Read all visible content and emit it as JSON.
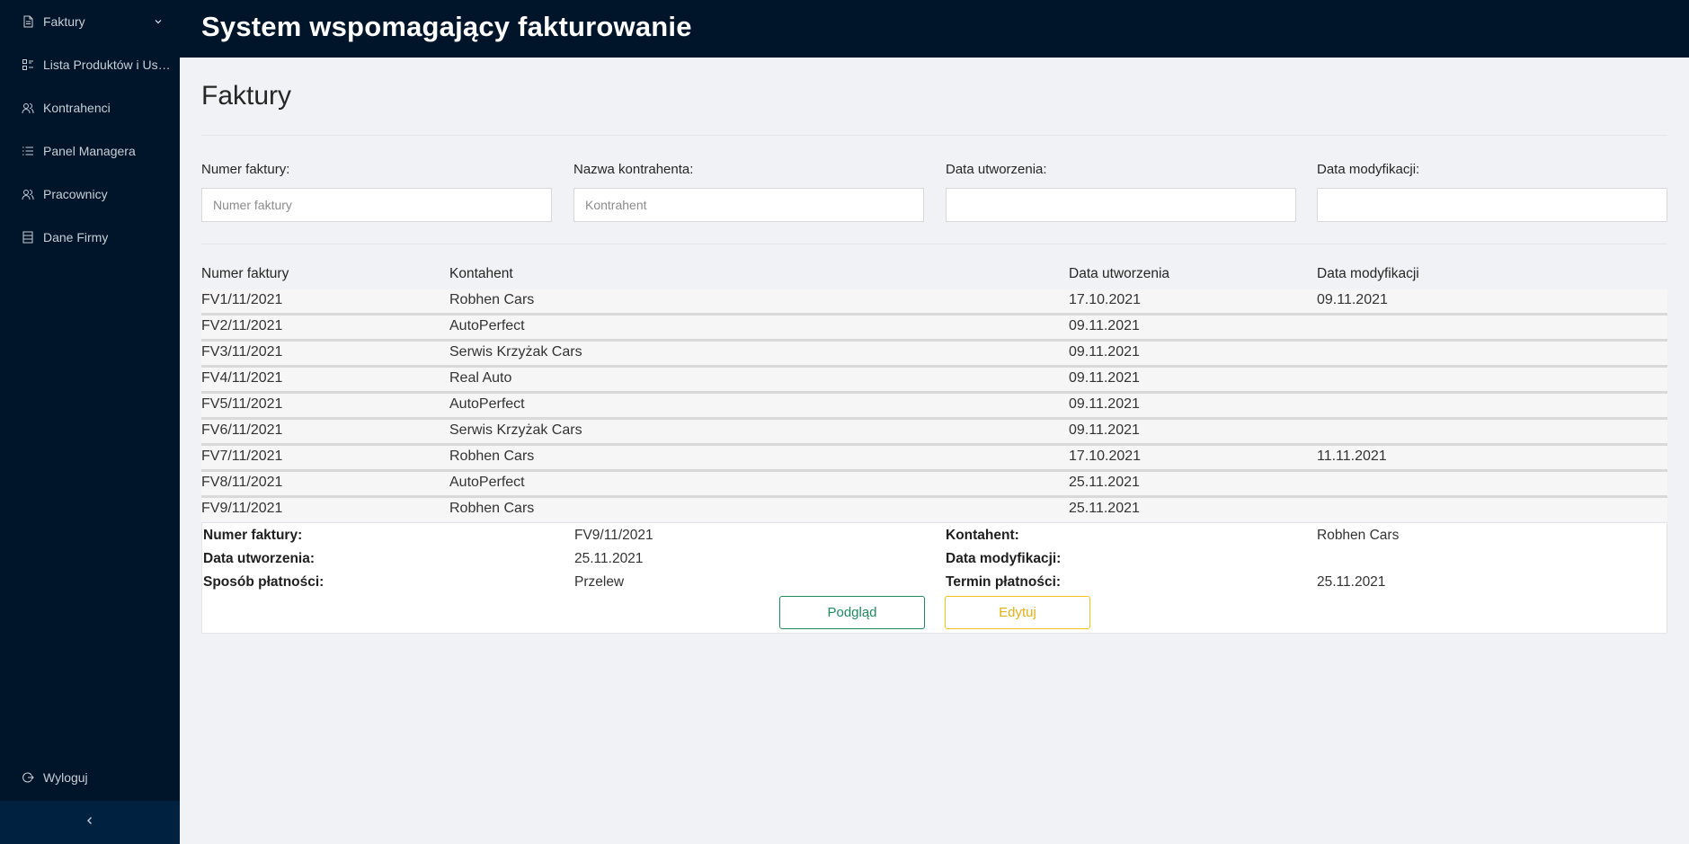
{
  "sidebar": {
    "items": [
      {
        "label": "Faktury",
        "icon": "file-icon"
      },
      {
        "label": "Lista Produktów i Usług",
        "icon": "product-list-icon"
      },
      {
        "label": "Kontrahenci",
        "icon": "users-icon"
      },
      {
        "label": "Panel Managera",
        "icon": "list-icon"
      },
      {
        "label": "Pracownicy",
        "icon": "team-icon"
      },
      {
        "label": "Dane Firmy",
        "icon": "document-icon"
      }
    ],
    "logout_label": "Wyloguj",
    "collapse_icon": "chevron-left-icon"
  },
  "header": {
    "title": "System wspomagający fakturowanie"
  },
  "page": {
    "title": "Faktury"
  },
  "filters": {
    "invoice_number": {
      "label": "Numer faktury:",
      "placeholder": "Numer faktury"
    },
    "contractor": {
      "label": "Nazwa kontrahenta:",
      "placeholder": "Kontrahent"
    },
    "created": {
      "label": "Data utworzenia:",
      "placeholder": ""
    },
    "modified": {
      "label": "Data modyfikacji:",
      "placeholder": ""
    }
  },
  "table": {
    "columns": [
      "Numer faktury",
      "Kontahent",
      "Data utworzenia",
      "Data modyfikacji"
    ],
    "rows": [
      [
        "FV1/11/2021",
        "Robhen Cars",
        "17.10.2021",
        "09.11.2021"
      ],
      [
        "FV2/11/2021",
        "AutoPerfect",
        "09.11.2021",
        ""
      ],
      [
        "FV3/11/2021",
        "Serwis Krzyżak Cars",
        "09.11.2021",
        ""
      ],
      [
        "FV4/11/2021",
        "Real Auto",
        "09.11.2021",
        ""
      ],
      [
        "FV5/11/2021",
        "AutoPerfect",
        "09.11.2021",
        ""
      ],
      [
        "FV6/11/2021",
        "Serwis Krzyżak Cars",
        "09.11.2021",
        ""
      ],
      [
        "FV7/11/2021",
        "Robhen Cars",
        "17.10.2021",
        "11.11.2021"
      ],
      [
        "FV8/11/2021",
        "AutoPerfect",
        "25.11.2021",
        ""
      ],
      [
        "FV9/11/2021",
        "Robhen Cars",
        "25.11.2021",
        ""
      ]
    ]
  },
  "details": {
    "invoice_number_label": "Numer faktury:",
    "invoice_number": "FV9/11/2021",
    "contractor_label": "Kontahent:",
    "contractor": "Robhen Cars",
    "created_label": "Data utworzenia:",
    "created": "25.11.2021",
    "modified_label": "Data modyfikacji:",
    "modified": "",
    "payment_method_label": "Sposób płatności:",
    "payment_method": "Przelew",
    "payment_due_label": "Termin płatności:",
    "payment_due": "25.11.2021",
    "preview_button": "Podgląd",
    "edit_button": "Edytuj"
  }
}
